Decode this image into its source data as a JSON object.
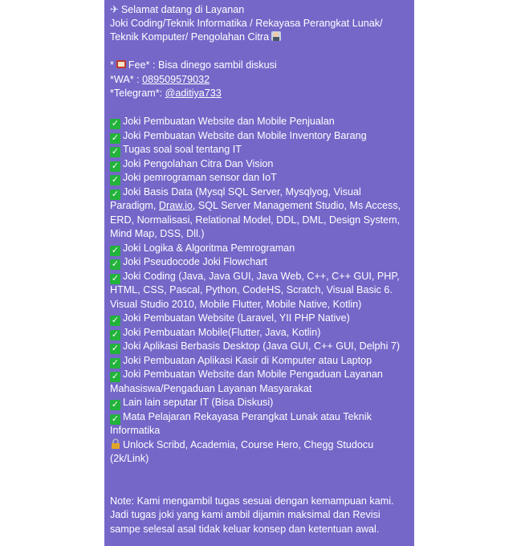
{
  "colors": {
    "bubble": "#7467c8",
    "check": "#22b33a",
    "text": "#ffffff"
  },
  "header": {
    "icon": "airplane-icon",
    "line1": "Selamat datang di Layanan",
    "line2": "Joki Coding/Teknik Informatika / Rekayasa Perangkat Lunak/",
    "line3": "Teknik Komputer/ Pengolahan Citra"
  },
  "contact": {
    "fee_prefix": "*",
    "fee_text": "Fee* : Bisa dinego sambil diskusi",
    "wa_label": "*WA* : ",
    "wa_value": "089509579032",
    "tg_label": "*Telegram*: ",
    "tg_value": "@aditiya733"
  },
  "services": [
    "Joki Pembuatan Website dan Mobile Penjualan",
    "Joki Pembuatan Website dan Mobile Inventory Barang",
    "Tugas soal soal tentang IT",
    "Joki Pengolahan Citra Dan Vision",
    "Joki pemrograman sensor dan IoT"
  ],
  "basis_data": {
    "line1": "Joki Basis Data (Mysql SQL Server, Mysqlyog, Visual",
    "line2_pre": "Paradigm, ",
    "line2_link": "Draw.io",
    "line2_post": ", SQL Server Management Studio, Ms Access,",
    "line3": "ERD, Normalisasi, Relational Model, DDL, DML, Design System,",
    "line4": "Mind Map, DSS, Dll.)"
  },
  "services2": [
    "Joki Logika & Algoritma Pemrograman",
    "Joki Pseudocode Joki Flowchart"
  ],
  "coding": {
    "line1": "Joki Coding (Java, Java GUI, Java Web, C++, C++ GUI, PHP,",
    "line2": "HTML, CSS, Pascal, Python, CodeHS, Scratch, Visual Basic 6.",
    "line3": "Visual Studio 2010, Mobile Flutter, Mobile Native, Kotlin)"
  },
  "services3": [
    "Joki Pembuatan Website (Laravel, YII PHP Native)",
    "Joki Pembuatan Mobile(Flutter, Java, Kotlin)",
    "Joki Aplikasi Berbasis Desktop (Java GUI, C++ GUI, Delphi 7)",
    "Joki Pembuatan Aplikasi Kasir di Komputer atau Laptop"
  ],
  "pengaduan": {
    "line1": "Joki Pembuatan Website dan Mobile Pengaduan Layanan",
    "line2": "Mahasiswa/Pengaduan Layanan Masyarakat"
  },
  "lain": "Lain lain seputar IT (Bisa Diskusi)",
  "mata_pelajaran": {
    "line1": "Mata Pelajaran Rekayasa Perangkat Lunak atau Teknik",
    "line2": "Informatika"
  },
  "unlock": {
    "icon": "lock-key-icon",
    "line1": "Unlock Scribd, Academia, Course Hero, Chegg Studocu",
    "line2": "(2k/Link)"
  },
  "note": {
    "line1": "Note: Kami mengambil tugas sesuai dengan kemampuan kami.",
    "line2": "Jadi tugas joki yang kami ambil dijamin maksimal dan Revisi",
    "line3": "sampe selesal asal tidak keluar konsep dan ketentuan awal."
  }
}
